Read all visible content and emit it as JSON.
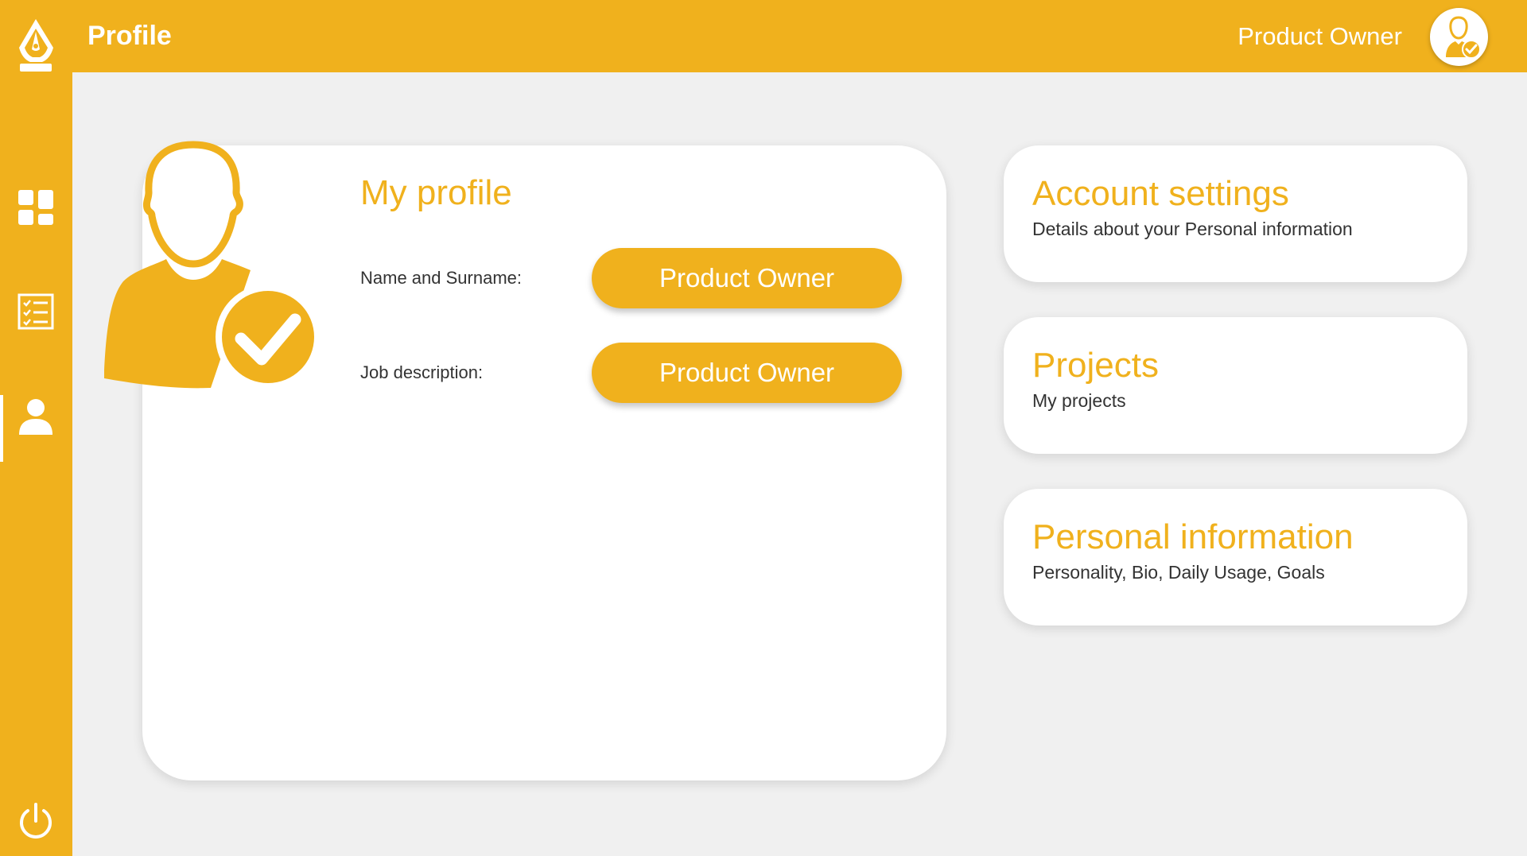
{
  "colors": {
    "accent": "#f0b11d",
    "background": "#f0f0f0",
    "card": "#ffffff",
    "text_dark": "#333333"
  },
  "header": {
    "title": "Profile",
    "user_name": "Product Owner"
  },
  "sidebar": {
    "logo_icon": "pen-nib-icon",
    "items": [
      {
        "name": "dashboard",
        "icon": "dashboard-grid-icon",
        "active": false
      },
      {
        "name": "tasks",
        "icon": "checklist-icon",
        "active": false
      },
      {
        "name": "profile",
        "icon": "user-icon",
        "active": true
      }
    ],
    "logout_icon": "power-icon"
  },
  "profile": {
    "heading": "My profile",
    "fields": [
      {
        "label": "Name and Surname:",
        "value": "Product Owner"
      },
      {
        "label": "Job description:",
        "value": "Product Owner"
      }
    ]
  },
  "cards": [
    {
      "title": "Account settings",
      "subtitle": "Details about your Personal information"
    },
    {
      "title": "Projects",
      "subtitle": "My projects"
    },
    {
      "title": "Personal information",
      "subtitle": "Personality, Bio, Daily Usage, Goals"
    }
  ]
}
